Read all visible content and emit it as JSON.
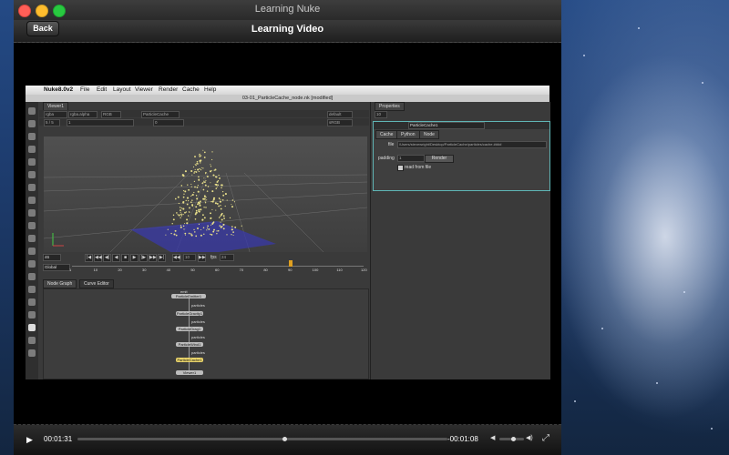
{
  "window": {
    "title": "Learning Nuke"
  },
  "header": {
    "back_label": "Back",
    "title": "Learning Video"
  },
  "nuke": {
    "menu": {
      "app": "Nuke8.0v2",
      "items": [
        "File",
        "Edit",
        "Layout",
        "Viewer",
        "Render",
        "Cache",
        "Help"
      ]
    },
    "doc_title": "03-01_ParticleCache_node.nk [modified]",
    "viewer": {
      "tab": "Viewer1",
      "row1": [
        "rgba",
        "rgba.alpha",
        "RGB",
        "ParticleCache",
        "default"
      ],
      "row2": [
        "5 / 5",
        "1",
        "0",
        "sRGB"
      ],
      "frame": "46",
      "fps_label": "fps",
      "fps_value": "24",
      "step": "10",
      "range_mode": "Global",
      "ticks": [
        "1",
        "10",
        "20",
        "30",
        "40",
        "50",
        "60",
        "70",
        "80",
        "90",
        "100",
        "110",
        "120"
      ],
      "status": "3D Scene 39 (fps: gui)"
    },
    "nodegraph": {
      "tabs": [
        "Node Graph",
        "Curve Editor"
      ],
      "nodes": [
        "ParticleEmitter1",
        "ParticleGravity1",
        "ParticleDrag1",
        "ParticleWind1",
        "ParticleCache1",
        "Viewer1"
      ],
      "labels": [
        "emit",
        "particles",
        "particles",
        "particles",
        "particles"
      ]
    },
    "properties": {
      "tab": "Properties",
      "node_name": "ParticleCache1",
      "count": "10",
      "subtabs": [
        "Cache",
        "Python",
        "Node"
      ],
      "file_label": "file",
      "file_value": "/Users/stevewright/Desktop/ParticleCache/particles/cache.####",
      "padding_label": "padding",
      "padding_value": "1",
      "render_label": "Render",
      "read_label": "read from file"
    }
  },
  "controls": {
    "current_time": "00:01:31",
    "remaining_time": "-00:01:08",
    "progress": 0.56,
    "volume": 0.55
  }
}
